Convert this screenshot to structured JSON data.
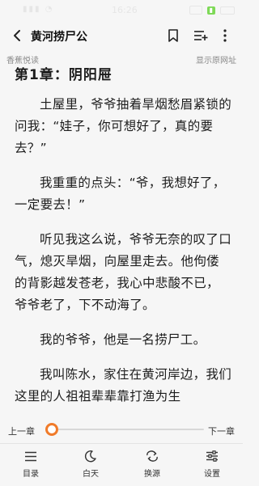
{
  "status_bar": {
    "time": "16:26"
  },
  "toolbar": {
    "title": "黄河捞尸公"
  },
  "subbar": {
    "source_name": "香蕉悦读",
    "view_original": "显示原网址"
  },
  "reader": {
    "chapter_title": "第1章：阴阳屉",
    "paragraphs": [
      "土屋里，爷爷抽着旱烟愁眉紧锁的问我：“娃子，你可想好了，真的要去？”",
      "我重重的点头：“爷，我想好了，一定要去！”",
      "听见我这么说，爷爷无奈的叹了口气，熄灭旱烟，向屋里走去。他佝偻的背影越发苍老，我心中悲酸不已，爷爷老了，下不动海了。",
      "我的爷爷，他是一名捞尸工。",
      "我叫陈水，家住在黄河岸边，我们这里的人祖祖辈辈靠打渔为生"
    ]
  },
  "progress": {
    "prev_label": "上一章",
    "next_label": "下一章",
    "value": 0.03,
    "accent_color": "#f07b2a"
  },
  "bottom_nav": {
    "items": [
      {
        "label": "目录",
        "icon": "list-icon"
      },
      {
        "label": "白天",
        "icon": "moon-icon"
      },
      {
        "label": "换源",
        "icon": "refresh-icon"
      },
      {
        "label": "设置",
        "icon": "sliders-icon"
      }
    ]
  }
}
